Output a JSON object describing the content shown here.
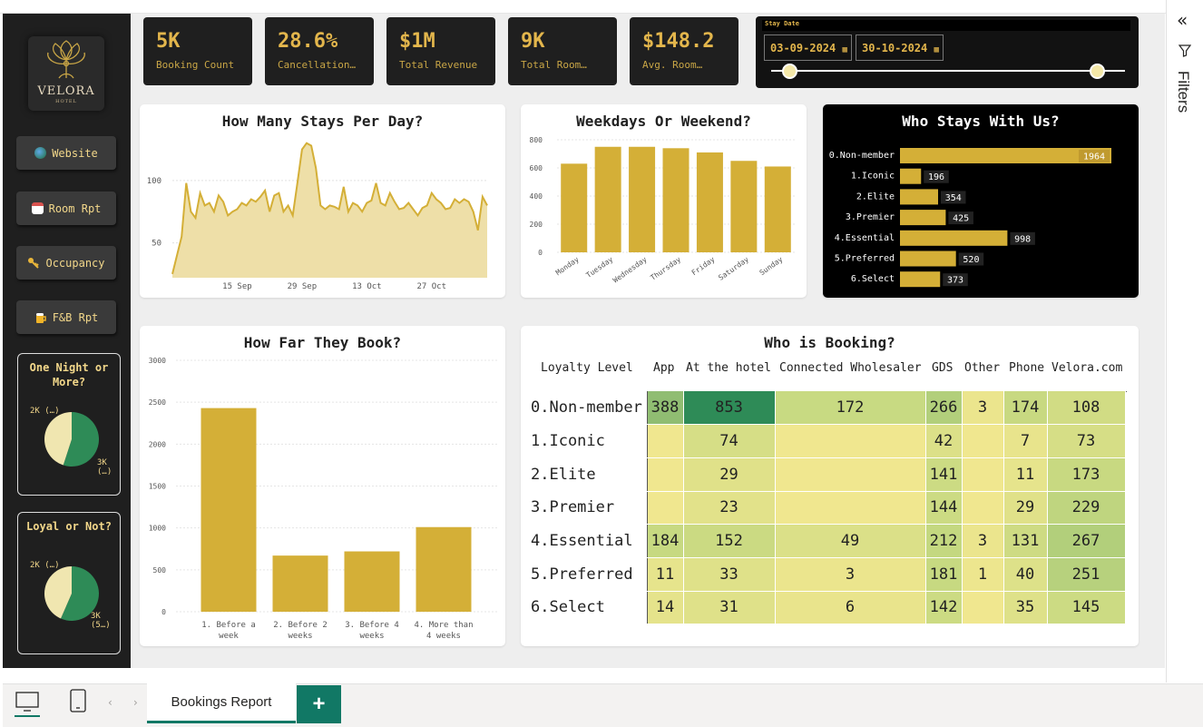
{
  "sidebar": {
    "logo": {
      "brand": "VELORA",
      "sub": "HOTEL"
    },
    "buttons": [
      {
        "label": "Website",
        "icon": "globe-icon"
      },
      {
        "label": "Room Rpt",
        "icon": "calendar-icon"
      },
      {
        "label": "Occupancy",
        "icon": "key-icon"
      },
      {
        "label": "F&B Rpt",
        "icon": "beer-icon"
      }
    ],
    "panels": [
      {
        "title": "One Night or More?",
        "slices": [
          {
            "label": "2K (…)",
            "value": 2
          },
          {
            "label": "3K (…)",
            "value": 3
          }
        ]
      },
      {
        "title": "Loyal or Not?",
        "slices": [
          {
            "label": "2K (…)",
            "value": 2
          },
          {
            "label": "3K (5…)",
            "value": 3
          }
        ]
      }
    ]
  },
  "kpis": [
    {
      "value": "5K",
      "label": "Booking Count"
    },
    {
      "value": "28.6%",
      "label": "Cancellation…"
    },
    {
      "value": "$1M",
      "label": "Total Revenue"
    },
    {
      "value": "9K",
      "label": "Total Room…"
    },
    {
      "value": "$148.2",
      "label": "Avg. Room…"
    }
  ],
  "slicer": {
    "header": "Stay Date",
    "start": "03-09-2024",
    "end": "30-10-2024",
    "start_frac": 0.05,
    "end_frac": 0.92
  },
  "colors": {
    "gold": "#d4af37",
    "dark_green": "#2e8b57",
    "light_fill": "#f0e6b0"
  },
  "filters_label": "Filters",
  "tab_label": "Bookings Report",
  "add_tab": "+",
  "chart_data": [
    {
      "type": "area",
      "title": "How Many Stays Per Day?",
      "x_ticks": [
        "15 Sep",
        "29 Sep",
        "13 Oct",
        "27 Oct"
      ],
      "y_ticks": [
        50,
        100
      ],
      "ylim": [
        22,
        132
      ],
      "values": [
        25,
        40,
        55,
        98,
        75,
        70,
        90,
        80,
        82,
        75,
        88,
        83,
        72,
        75,
        77,
        82,
        80,
        85,
        83,
        87,
        92,
        75,
        88,
        90,
        75,
        80,
        72,
        98,
        125,
        130,
        128,
        110,
        80,
        77,
        80,
        79,
        77,
        95,
        75,
        82,
        80,
        75,
        82,
        84,
        98,
        82,
        80,
        90,
        83,
        77,
        78,
        82,
        77,
        72,
        78,
        80,
        90,
        85,
        82,
        77,
        78,
        85,
        82,
        85,
        83,
        75,
        60,
        87,
        80
      ]
    },
    {
      "type": "bar",
      "title": "Weekdays Or Weekend?",
      "categories": [
        "Monday",
        "Tuesday",
        "Wednesday",
        "Thursday",
        "Friday",
        "Saturday",
        "Sunday"
      ],
      "values": [
        630,
        750,
        750,
        740,
        710,
        650,
        610
      ],
      "y_ticks": [
        0,
        200,
        400,
        600,
        800
      ],
      "ylim": [
        0,
        800
      ]
    },
    {
      "type": "bar",
      "title": "Who Stays With Us?",
      "categories": [
        "0.Non-member",
        "1.Iconic",
        "2.Elite",
        "3.Premier",
        "4.Essential",
        "5.Preferred",
        "6.Select"
      ],
      "values": [
        1964,
        196,
        354,
        425,
        998,
        520,
        373
      ],
      "xlim": [
        0,
        2100
      ]
    },
    {
      "type": "bar",
      "title": "How Far They Book?",
      "categories": [
        "1. Before a week",
        "2. Before 2 weeks",
        "3. Before 4 weeks",
        "4. More than 4 weeks"
      ],
      "category_lines": [
        [
          "1. Before a",
          "week"
        ],
        [
          "2. Before 2",
          "weeks"
        ],
        [
          "3. Before 4",
          "weeks"
        ],
        [
          "4. More than",
          "4 weeks"
        ]
      ],
      "values": [
        2430,
        670,
        720,
        1010
      ],
      "y_ticks": [
        0,
        500,
        1000,
        1500,
        2000,
        2500,
        3000
      ],
      "ylim": [
        0,
        3000
      ]
    },
    {
      "type": "table",
      "title": "Who is Booking?",
      "row_header": "Loyalty Level",
      "columns": [
        "App",
        "At the hotel",
        "Connected Wholesaler",
        "GDS",
        "Other",
        "Phone",
        "Velora.com"
      ],
      "rows": [
        {
          "label": "0.Non-member",
          "cells": [
            "388",
            "853",
            "172",
            "266",
            "3",
            "174",
            "108"
          ]
        },
        {
          "label": "1.Iconic",
          "cells": [
            "",
            "74",
            "",
            "42",
            "",
            "7",
            "73"
          ]
        },
        {
          "label": "2.Elite",
          "cells": [
            "",
            "29",
            "",
            "141",
            "",
            "11",
            "173"
          ]
        },
        {
          "label": "3.Premier",
          "cells": [
            "",
            "23",
            "",
            "144",
            "",
            "29",
            "229"
          ]
        },
        {
          "label": "4.Essential",
          "cells": [
            "184",
            "152",
            "49",
            "212",
            "3",
            "131",
            "267"
          ]
        },
        {
          "label": "5.Preferred",
          "cells": [
            "11",
            "33",
            "3",
            "181",
            "1",
            "40",
            "251"
          ]
        },
        {
          "label": "6.Select",
          "cells": [
            "14",
            "31",
            "6",
            "142",
            "",
            "35",
            "145"
          ]
        }
      ]
    }
  ]
}
